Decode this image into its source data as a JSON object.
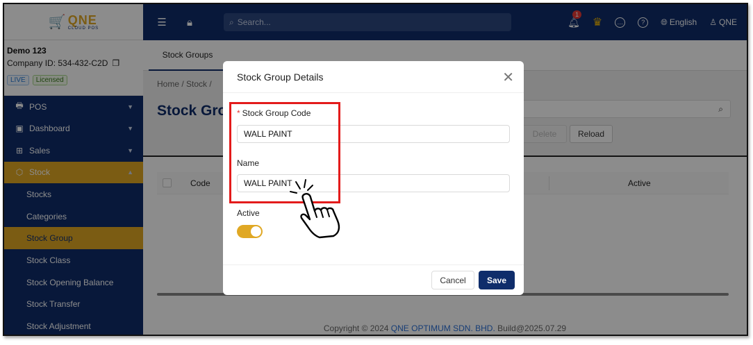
{
  "logo": {
    "brand": "QNE",
    "sub": "CLOUD POS"
  },
  "company": {
    "name": "Demo 123",
    "id_label": "Company ID: 534-432-C2D",
    "badge_live": "LIVE",
    "badge_license": "Licensed"
  },
  "sidebar": {
    "items": [
      {
        "label": "POS",
        "icon": "pos-icon"
      },
      {
        "label": "Dashboard",
        "icon": "dashboard-icon"
      },
      {
        "label": "Sales",
        "icon": "sales-icon"
      },
      {
        "label": "Stock",
        "icon": "stock-icon"
      }
    ],
    "sub_items": [
      {
        "label": "Stocks"
      },
      {
        "label": "Categories"
      },
      {
        "label": "Stock Group"
      },
      {
        "label": "Stock Class"
      },
      {
        "label": "Stock Opening Balance"
      },
      {
        "label": "Stock Transfer"
      },
      {
        "label": "Stock Adjustment"
      }
    ]
  },
  "header": {
    "search_placeholder": "Search...",
    "notification_count": "1",
    "language": "English",
    "user": "QNE"
  },
  "main": {
    "tab": "Stock Groups",
    "breadcrumb": "Home  /  Stock  /",
    "title": "Stock Gro",
    "delete_label": "Delete",
    "reload_label": "Reload",
    "col_code": "Code",
    "col_active": "Active"
  },
  "footer": {
    "prefix": "Copyright © 2024",
    "company": "QNE OPTIMUM SDN. BHD.",
    "build": "Build@2025.07.29"
  },
  "modal": {
    "title": "Stock Group Details",
    "code_label": "Stock Group Code",
    "code_value": "WALL PAINT",
    "name_label": "Name",
    "name_value": "WALL PAINT",
    "active_label": "Active",
    "active": true,
    "cancel_label": "Cancel",
    "save_label": "Save"
  },
  "colors": {
    "navy": "#0f2d6b",
    "gold": "#e0a824",
    "highlight": "#e31b1b"
  }
}
